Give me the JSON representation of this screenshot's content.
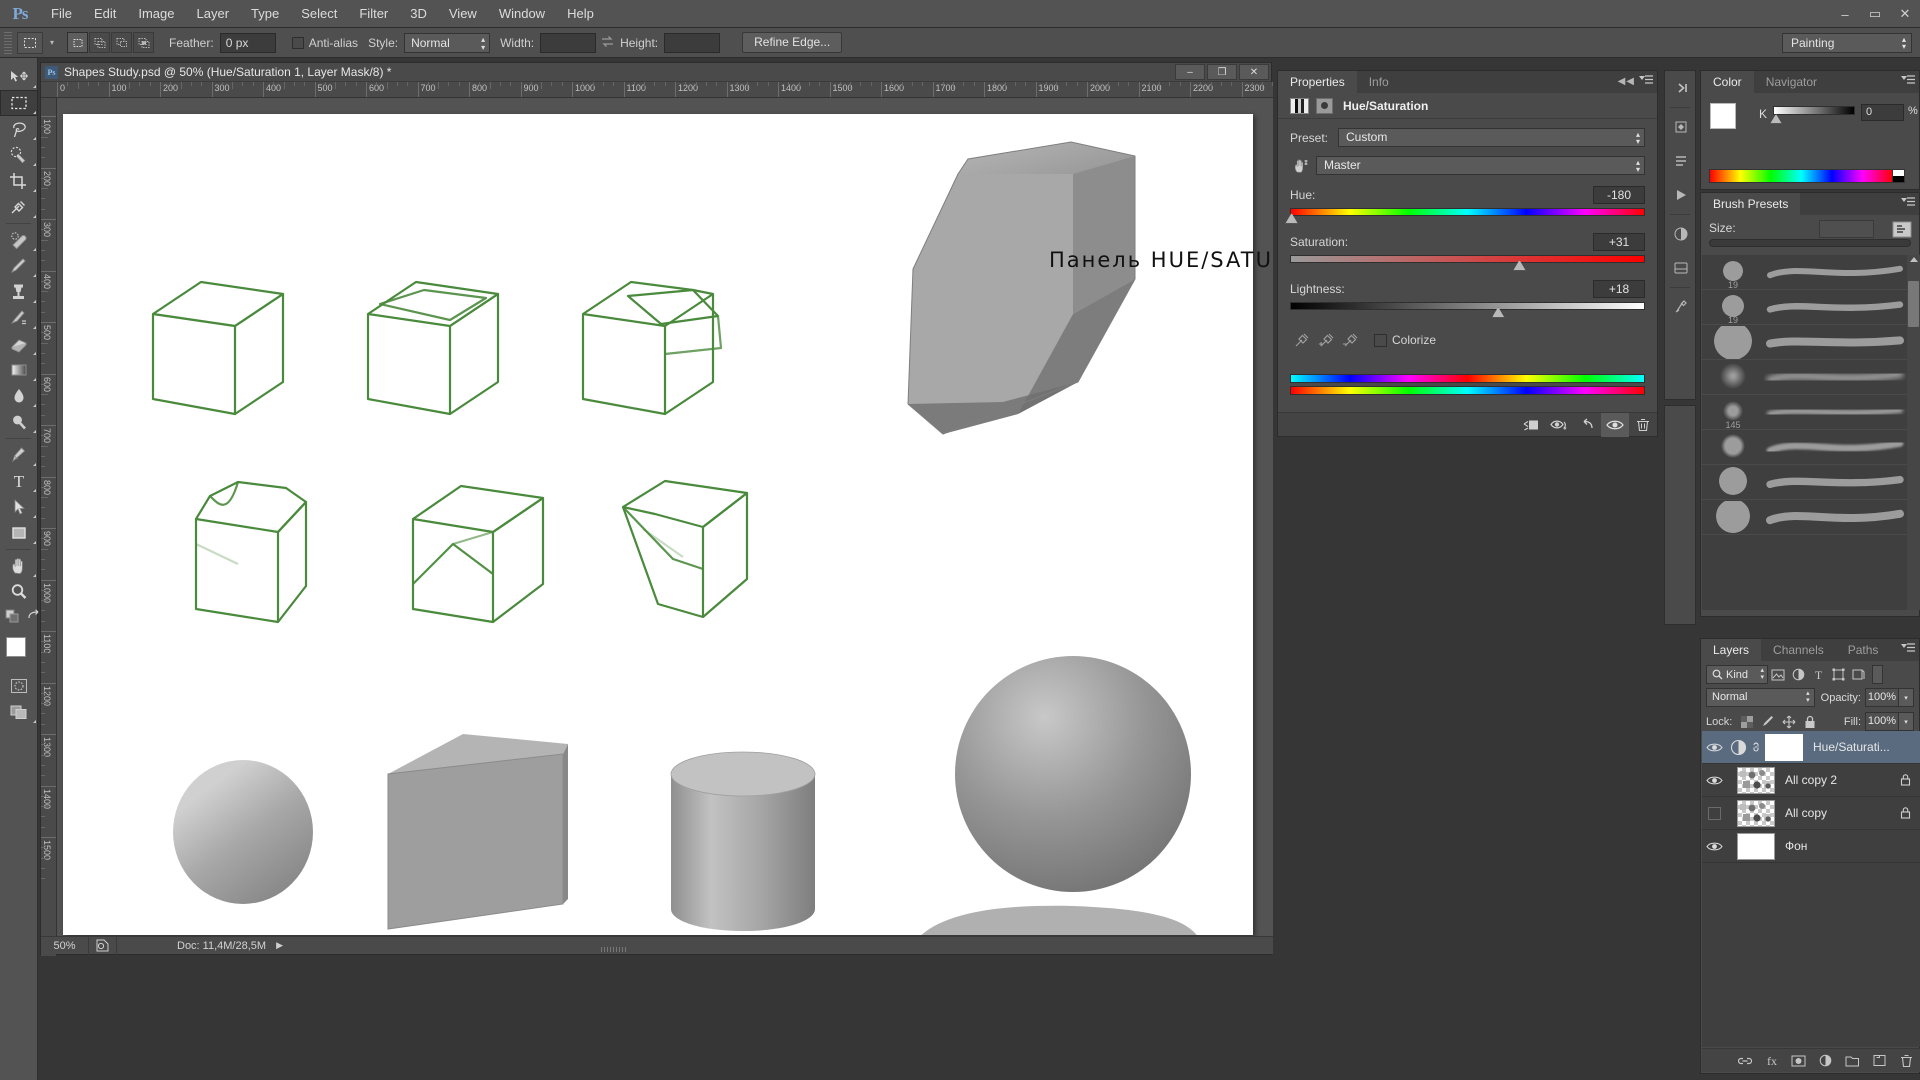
{
  "app": {
    "logo": "Ps",
    "menus": [
      "File",
      "Edit",
      "Image",
      "Layer",
      "Type",
      "Select",
      "Filter",
      "3D",
      "View",
      "Window",
      "Help"
    ],
    "window_buttons": {
      "minimize": "–",
      "maximize": "▭",
      "close": "✕"
    }
  },
  "options_bar": {
    "tool": "rectangular-marquee",
    "feather_label": "Feather:",
    "feather_value": "0 px",
    "antialias_label": "Anti-alias",
    "antialias_checked": false,
    "style_label": "Style:",
    "style_value": "Normal",
    "width_label": "Width:",
    "width_value": "",
    "height_label": "Height:",
    "height_value": "",
    "refine_edge_label": "Refine Edge...",
    "workspace": "Painting"
  },
  "toolbar": {
    "tools": [
      {
        "name": "move-tool",
        "active": false
      },
      {
        "name": "rectangular-marquee-tool",
        "active": true
      },
      {
        "name": "lasso-tool",
        "active": false
      },
      {
        "name": "quick-selection-tool",
        "active": false
      },
      {
        "name": "crop-tool",
        "active": false
      },
      {
        "name": "eyedropper-tool",
        "active": false
      },
      {
        "name": "spot-healing-brush-tool",
        "active": false
      },
      {
        "name": "brush-tool",
        "active": false
      },
      {
        "name": "clone-stamp-tool",
        "active": false
      },
      {
        "name": "history-brush-tool",
        "active": false
      },
      {
        "name": "eraser-tool",
        "active": false
      },
      {
        "name": "gradient-tool",
        "active": false
      },
      {
        "name": "blur-tool",
        "active": false
      },
      {
        "name": "dodge-tool",
        "active": false
      },
      {
        "name": "pen-tool",
        "active": false
      },
      {
        "name": "type-tool",
        "active": false
      },
      {
        "name": "path-selection-tool",
        "active": false
      },
      {
        "name": "rectangle-tool",
        "active": false
      },
      {
        "name": "hand-tool",
        "active": false
      },
      {
        "name": "zoom-tool",
        "active": false
      }
    ],
    "foreground_color": "#ffffff",
    "background_color": "#000000"
  },
  "document": {
    "title": "Shapes Study.psd @ 50% (Hue/Saturation 1, Layer Mask/8) *",
    "window_buttons": {
      "minimize": "–",
      "restore": "❐",
      "close": "✕"
    },
    "ruler_units_h": [
      "0",
      "100",
      "200",
      "300",
      "400",
      "500",
      "600",
      "700",
      "800",
      "900",
      "1000",
      "1100",
      "1200",
      "1300",
      "1400",
      "1500",
      "1600",
      "1700",
      "1800",
      "1900",
      "2000",
      "2100",
      "2200",
      "2300"
    ],
    "ruler_units_v": [
      "100",
      "200",
      "300",
      "400",
      "500",
      "600",
      "700",
      "800",
      "900",
      "1000",
      "1100",
      "1200",
      "1300",
      "1400",
      "1500"
    ],
    "annotation": "Панель  HUE/SATURATION  —>",
    "status": {
      "zoom": "50%",
      "doc_info": "Doc: 11,4M/28,5M",
      "arrow": "▶"
    }
  },
  "properties_panel": {
    "tabs": [
      {
        "label": "Properties",
        "active": true
      },
      {
        "label": "Info",
        "active": false
      }
    ],
    "title": "Hue/Saturation",
    "preset_label": "Preset:",
    "preset_value": "Custom",
    "channel_value": "Master",
    "sliders": [
      {
        "label": "Hue:",
        "value": "-180",
        "percent": 0.3,
        "track": "hue"
      },
      {
        "label": "Saturation:",
        "value": "+31",
        "percent": 64.5,
        "track": "sat"
      },
      {
        "label": "Lightness:",
        "value": "+18",
        "percent": 58.5,
        "track": "light"
      }
    ],
    "colorize_label": "Colorize",
    "colorize_checked": false,
    "footer_buttons": [
      "clip-to-layer-icon",
      "toggle-previous-state-icon",
      "reset-icon",
      "visibility-icon",
      "delete-icon"
    ]
  },
  "color_panel": {
    "tabs": [
      {
        "label": "Color",
        "active": true
      },
      {
        "label": "Navigator",
        "active": false
      }
    ],
    "channel_label": "K",
    "channel_value": "0",
    "unit": "%"
  },
  "brush_panel": {
    "tabs": [
      {
        "label": "Brush Presets",
        "active": true
      }
    ],
    "size_label": "Size:",
    "size_value": "",
    "presets": [
      {
        "size": ""
      },
      {
        "size": ""
      },
      {
        "size": ""
      },
      {
        "size": "145"
      },
      {
        "size": ""
      },
      {
        "size": ""
      },
      {
        "size": "19"
      },
      {
        "size": "19"
      }
    ]
  },
  "layers_panel": {
    "tabs": [
      {
        "label": "Layers",
        "active": true
      },
      {
        "label": "Channels",
        "active": false
      },
      {
        "label": "Paths",
        "active": false
      }
    ],
    "filter_kind": "Kind",
    "blend_mode": "Normal",
    "opacity_label": "Opacity:",
    "opacity_value": "100%",
    "lock_label": "Lock:",
    "fill_label": "Fill:",
    "fill_value": "100%",
    "layers": [
      {
        "name": "Hue/Saturati...",
        "visible": true,
        "selected": true,
        "type": "adjustment",
        "locked": false,
        "linked": true
      },
      {
        "name": "All copy 2",
        "visible": true,
        "selected": false,
        "type": "pixel",
        "locked": true,
        "linked": false
      },
      {
        "name": "All copy",
        "visible": false,
        "selected": false,
        "type": "pixel",
        "locked": true,
        "linked": false
      },
      {
        "name": "Фон",
        "visible": true,
        "selected": false,
        "type": "background",
        "locked": false,
        "linked": false
      }
    ],
    "footer_buttons": [
      "link-layers-icon",
      "layer-style-icon",
      "add-mask-icon",
      "new-adjustment-icon",
      "new-group-icon",
      "new-layer-icon",
      "delete-layer-icon"
    ]
  },
  "colors": {
    "menu_bg": "#535353",
    "panel_bg": "#4a4a4a",
    "panel_dark": "#3f3f3f",
    "selection_blue": "#5a6b80",
    "canvas_bg": "#535353",
    "paper": "#ffffff",
    "shape_outline": "#4a8a3c"
  }
}
